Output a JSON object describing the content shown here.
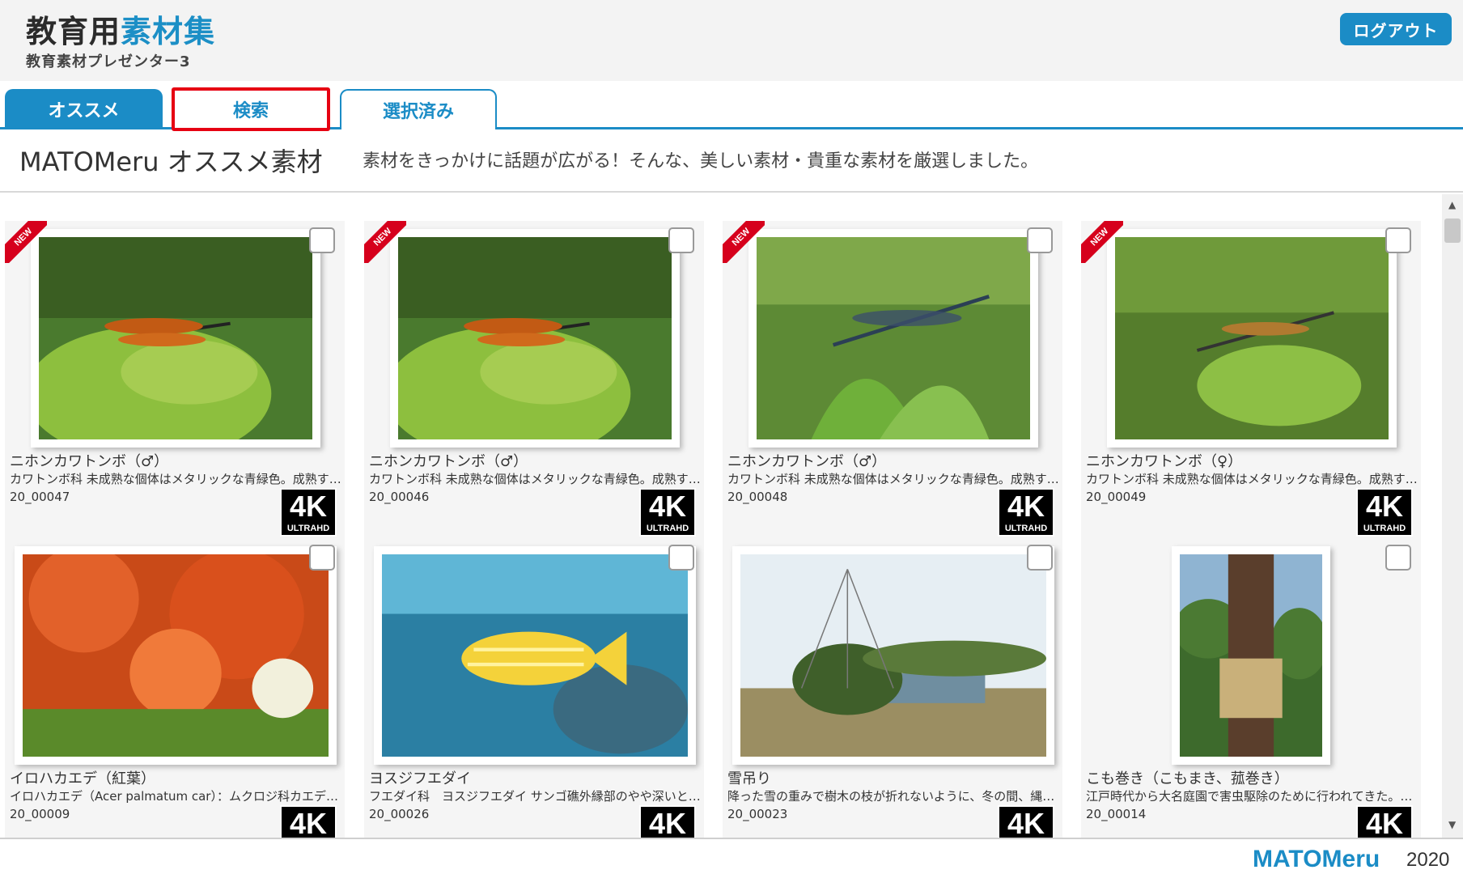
{
  "header": {
    "logo_main_a": "教育用",
    "logo_main_b": "素材集",
    "logo_sub": "教育素材プレゼンター3",
    "logout_label": "ログアウト"
  },
  "tabs": [
    {
      "label": "オススメ",
      "active": true
    },
    {
      "label": "検索",
      "active": false,
      "highlighted": true
    },
    {
      "label": "選択済み",
      "active": false
    }
  ],
  "section": {
    "title": "MATOMeru オススメ素材",
    "description": "素材をきっかけに話題が広がる！そんな、美しい素材・貴重な素材を厳選しました。"
  },
  "badge": {
    "big": "4K",
    "small": "ULTRAHD",
    "new": "NEW"
  },
  "cards": [
    {
      "title": "ニホンカワトンボ（♂）",
      "desc": "カワトンボ科 未成熟な個体はメタリックな青緑色。成熟す…",
      "id": "20_00047",
      "is_new": true,
      "image": "dragonfly-orange"
    },
    {
      "title": "ニホンカワトンボ（♂）",
      "desc": "カワトンボ科 未成熟な個体はメタリックな青緑色。成熟す…",
      "id": "20_00046",
      "is_new": true,
      "image": "dragonfly-orange"
    },
    {
      "title": "ニホンカワトンボ（♂）",
      "desc": "カワトンボ科 未成熟な個体はメタリックな青緑色。成熟す…",
      "id": "20_00048",
      "is_new": true,
      "image": "dragonfly-blue"
    },
    {
      "title": "ニホンカワトンボ（♀）",
      "desc": "カワトンボ科 未成熟な個体はメタリックな青緑色。成熟す…",
      "id": "20_00049",
      "is_new": true,
      "image": "dragonfly-green"
    },
    {
      "title": "イロハカエデ（紅葉）",
      "desc": "イロハカエデ（Acer palmatum car）：ムクロジ科カエデ属…",
      "id": "20_00009",
      "is_new": false,
      "image": "maple"
    },
    {
      "title": "ヨスジフエダイ",
      "desc": "フエダイ科　ヨスジフエダイ サンゴ礁外縁部のやや深いと…",
      "id": "20_00026",
      "is_new": false,
      "image": "fish"
    },
    {
      "title": "雪吊り",
      "desc": "降った雪の重みで樹木の枝が折れないように、冬の間、縄で…",
      "id": "20_00023",
      "is_new": false,
      "image": "yukitsuri"
    },
    {
      "title": "こも巻き（こもまき、菰巻き）",
      "desc": "江戸時代から大名庭園で害虫駆除のために行われてきた。「…",
      "id": "20_00014",
      "is_new": false,
      "image": "komomaki"
    }
  ],
  "footer": {
    "logo": "MATOMeru",
    "year": "2020"
  },
  "colors": {
    "accent": "#1b8cc6",
    "highlight": "#e60012",
    "new": "#d6001c"
  }
}
